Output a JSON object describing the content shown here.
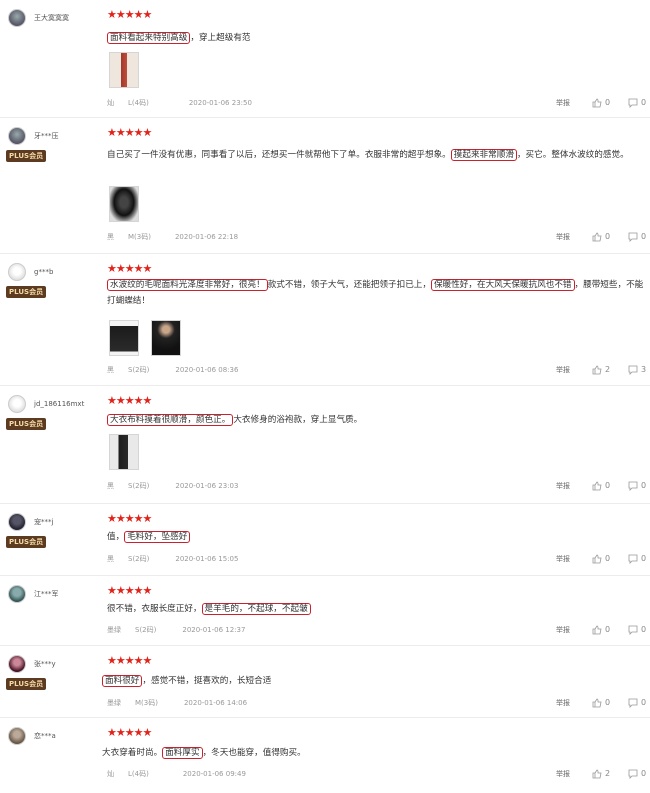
{
  "reviews": [
    {
      "user": "王大寞寞寞",
      "plus": false,
      "stars": "★★★★★",
      "segments": [
        {
          "t": "面料看起来特别高级",
          "hl": true
        },
        {
          "t": "，穿上超级有范",
          "hl": false
        }
      ],
      "color": "灿",
      "size": "L(4码)",
      "date": "2020-01-06 23:50",
      "report": "举报",
      "likes": "0",
      "comments": "0"
    },
    {
      "user": "牙***压",
      "plus": true,
      "plus_label": "PLUS会员",
      "stars": "★★★★★",
      "segments": [
        {
          "t": "自己买了一件没有优惠，同事看了以后，还想买一件就帮他下了单。衣服非常的超乎想象。",
          "hl": false
        },
        {
          "t": "摸起来非常顺滑",
          "hl": true
        },
        {
          "t": "，买它。整体水波纹的感觉。",
          "hl": false
        }
      ],
      "color": "黑",
      "size": "M(3码)",
      "date": "2020-01-06 22:18",
      "report": "举报",
      "likes": "0",
      "comments": "0"
    },
    {
      "user": "g***b",
      "plus": true,
      "plus_label": "PLUS会员",
      "stars": "★★★★★",
      "segments": [
        {
          "t": "水波纹的毛呢面料光泽度非常好，很亮！",
          "hl": true
        },
        {
          "t": "款式不错，领子大气，还能把领子扣已上，",
          "hl": false
        },
        {
          "t": "保暖性好，在大风天保暖抗风也不错",
          "hl": true
        },
        {
          "t": "，腰带短些，不能打蝴蝶结！",
          "hl": false
        }
      ],
      "color": "黑",
      "size": "S(2码)",
      "date": "2020-01-06 08:36",
      "report": "举报",
      "likes": "2",
      "comments": "3"
    },
    {
      "user": "jd_186116mxt",
      "plus": true,
      "plus_label": "PLUS会员",
      "stars": "★★★★★",
      "segments": [
        {
          "t": "大衣布料摸着很顺滑，颜色正。",
          "hl": true
        },
        {
          "t": "大衣修身的浴袍款，穿上显气质。",
          "hl": false
        }
      ],
      "color": "黑",
      "size": "S(2码)",
      "date": "2020-01-06 23:03",
      "report": "举报",
      "likes": "0",
      "comments": "0"
    },
    {
      "user": "宠***j",
      "plus": true,
      "plus_label": "PLUS会员",
      "stars": "★★★★★",
      "segments": [
        {
          "t": "值，",
          "hl": false
        },
        {
          "t": "毛料好，坠感好",
          "hl": true
        }
      ],
      "color": "黑",
      "size": "S(2码)",
      "date": "2020-01-06 15:05",
      "report": "举报",
      "likes": "0",
      "comments": "0"
    },
    {
      "user": "江***军",
      "plus": false,
      "stars": "★★★★★",
      "segments": [
        {
          "t": "很不错，衣服长度正好，",
          "hl": false
        },
        {
          "t": "是羊毛的，不起球，不起皱",
          "hl": true
        }
      ],
      "color": "墨绿",
      "size": "S(2码)",
      "date": "2020-01-06 12:37",
      "report": "举报",
      "likes": "0",
      "comments": "0"
    },
    {
      "user": "张***y",
      "plus": true,
      "plus_label": "PLUS会员",
      "stars": "★★★★★",
      "segments": [
        {
          "t": "面料很好",
          "hl": true
        },
        {
          "t": "，感觉不错，挺喜欢的，长短合适",
          "hl": false
        }
      ],
      "color": "墨绿",
      "size": "M(3码)",
      "date": "2020-01-06 14:06",
      "report": "举报",
      "likes": "0",
      "comments": "0"
    },
    {
      "user": "恋***a",
      "plus": false,
      "stars": "★★★★★",
      "segments": [
        {
          "t": "大衣穿着时尚。",
          "hl": false
        },
        {
          "t": "面料厚实",
          "hl": true
        },
        {
          "t": "，冬天也能穿，值得购买。",
          "hl": false
        }
      ],
      "color": "灿",
      "size": "L(4码)",
      "date": "2020-01-06 09:49",
      "report": "举报",
      "likes": "2",
      "comments": "0"
    }
  ]
}
